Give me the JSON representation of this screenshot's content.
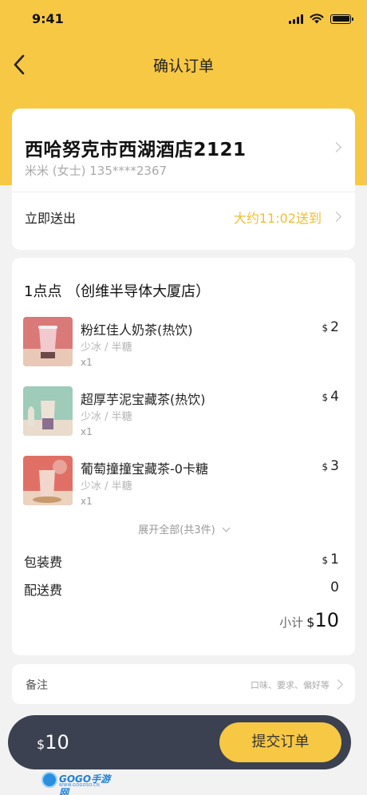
{
  "status_bar": {
    "time": "9:41"
  },
  "nav": {
    "title": "确认订单"
  },
  "address": {
    "main": "西哈努克市西湖酒店2121",
    "contact": "米米 (女士) 135****2367",
    "deliver_label": "立即送出",
    "deliver_time": "大约11:02送到"
  },
  "order": {
    "shop_name": "1点点 （创维半导体大厦店）",
    "currency": "$",
    "items": [
      {
        "name": "粉红佳人奶茶(热饮)",
        "spec": "少冰 / 半糖",
        "qty": "x1",
        "price": "2"
      },
      {
        "name": "超厚芋泥宝藏茶(热饮)",
        "spec": "少冰 / 半糖",
        "qty": "x1",
        "price": "4"
      },
      {
        "name": "葡萄撞撞宝藏茶-0卡糖",
        "spec": "少冰 / 半糖",
        "qty": "x1",
        "price": "3"
      }
    ],
    "expand_label": "展开全部(共3件)",
    "packaging_label": "包装费",
    "packaging_fee": "1",
    "delivery_label": "配送费",
    "delivery_fee": "0",
    "subtotal_label": "小计",
    "subtotal": "10"
  },
  "remark": {
    "label": "备注",
    "hint": "口味、要求、偏好等"
  },
  "footer": {
    "total": "10",
    "submit_label": "提交订单"
  },
  "watermark": {
    "text": "GOGO手游网",
    "sub": "WWW.GOGOSO.CN"
  }
}
